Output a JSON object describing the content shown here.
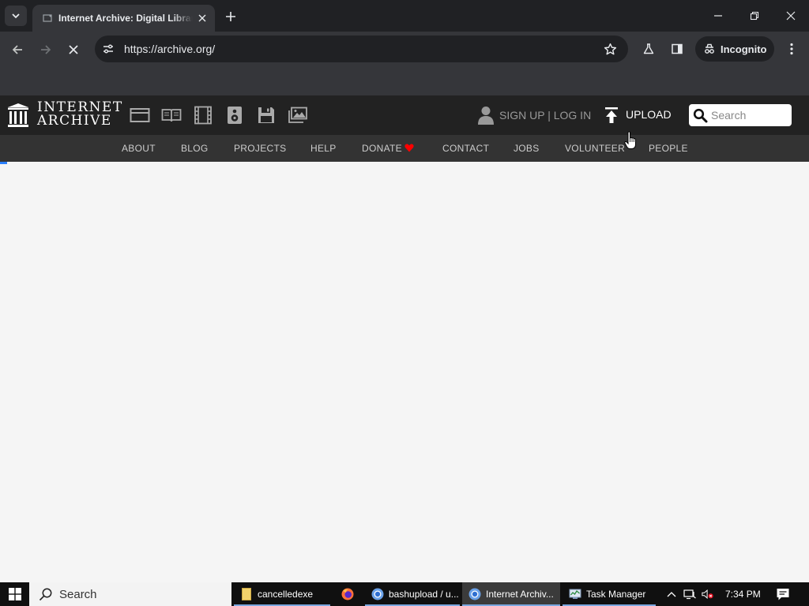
{
  "browser": {
    "tab_title": "Internet Archive: Digital Library of Free & Borrowable Books, Movies, Music & Wayback Machine",
    "url": "https://archive.org/",
    "incognito_label": "Incognito"
  },
  "archive": {
    "logo_line1": "INTERNET",
    "logo_line2": "ARCHIVE",
    "media_icons": [
      "web-icon",
      "texts-icon",
      "video-icon",
      "audio-icon",
      "software-icon",
      "images-icon"
    ],
    "account": "SIGN UP | LOG IN",
    "upload": "UPLOAD",
    "search_placeholder": "Search",
    "nav": [
      "ABOUT",
      "BLOG",
      "PROJECTS",
      "HELP",
      "DONATE",
      "CONTACT",
      "JOBS",
      "VOLUNTEER",
      "PEOPLE"
    ],
    "donate_heart_color": "#ff0000"
  },
  "taskbar": {
    "search_label": "Search",
    "tasks": [
      {
        "label": "cancelledexe",
        "icon": "folder-icon"
      },
      {
        "label": "",
        "icon": "firefox-icon"
      },
      {
        "label": "bashupload / u...",
        "icon": "chrome-icon"
      },
      {
        "label": "Internet Archiv...",
        "icon": "chrome-icon"
      },
      {
        "label": "Task Manager",
        "icon": "task-manager-icon"
      }
    ],
    "clock": "7:34 PM"
  },
  "colors": {
    "tabstrip": "#202124",
    "toolbar": "#35363a",
    "ia_header": "#222222",
    "ia_nav": "#333333",
    "page_bg": "#f5f5f5",
    "progress": "#2a7fff"
  }
}
